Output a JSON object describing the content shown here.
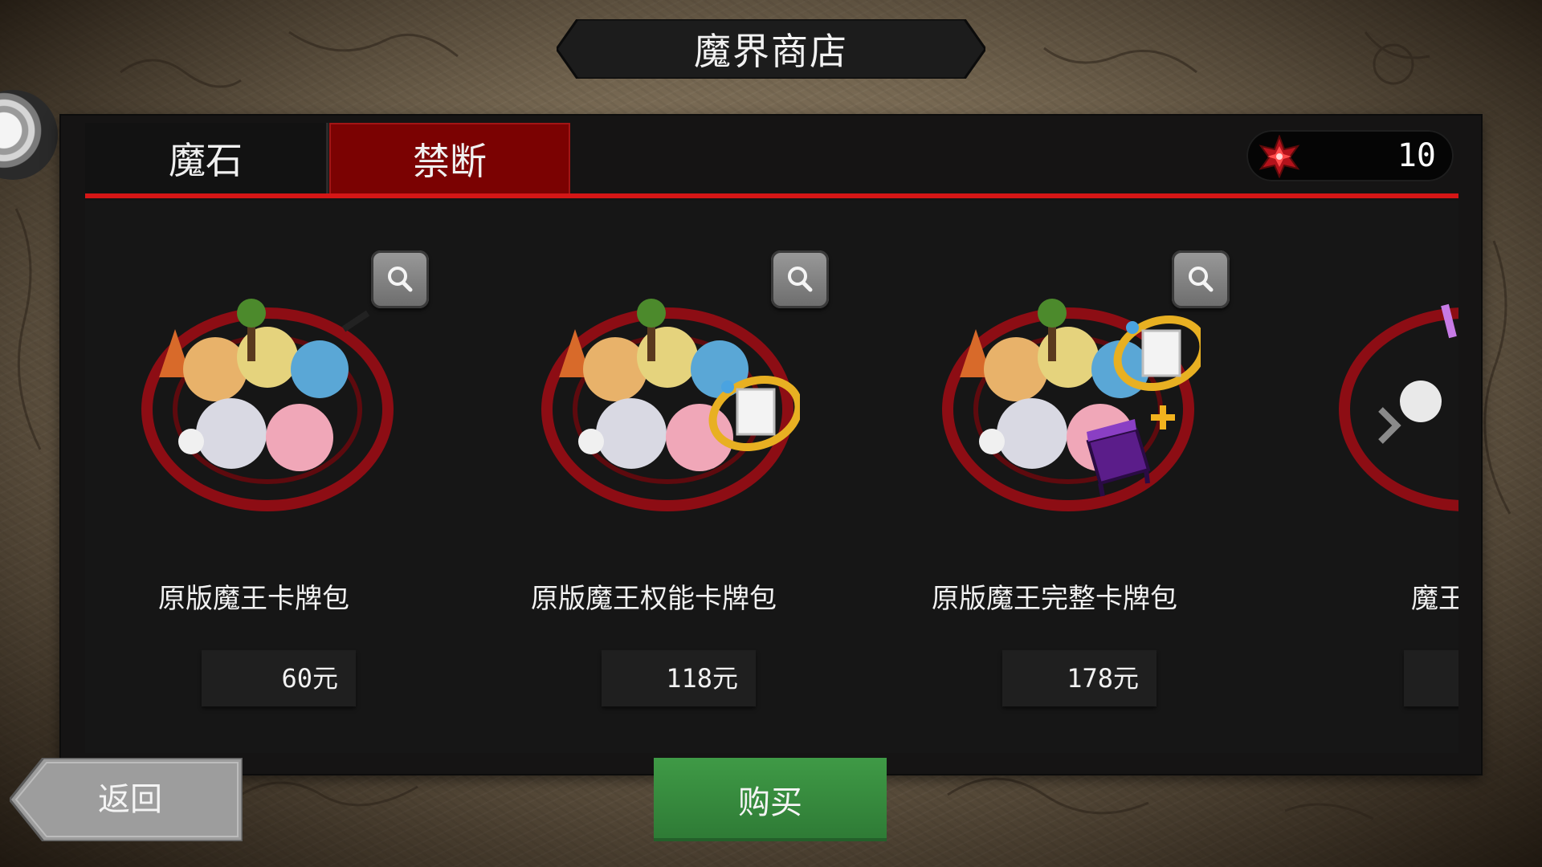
{
  "header": {
    "title": "魔界商店"
  },
  "tabs": [
    {
      "label": "魔石",
      "active": false
    },
    {
      "label": "禁断",
      "active": true
    }
  ],
  "currency": {
    "icon": "red-gem-icon",
    "value": "10"
  },
  "products": [
    {
      "name": "原版魔王卡牌包",
      "price": "60元",
      "extra": "none"
    },
    {
      "name": "原版魔王权能卡牌包",
      "price": "118元",
      "extra": "ring-card"
    },
    {
      "name": "原版魔王完整卡牌包",
      "price": "178元",
      "extra": "ring-card-plus-chest"
    },
    {
      "name": "魔王",
      "price": ""
    }
  ],
  "footer": {
    "back_label": "返回",
    "buy_label": "购买"
  },
  "colors": {
    "accent_red": "#d51616",
    "active_tab": "#7b0202",
    "buy_green": "#3a8f41"
  }
}
